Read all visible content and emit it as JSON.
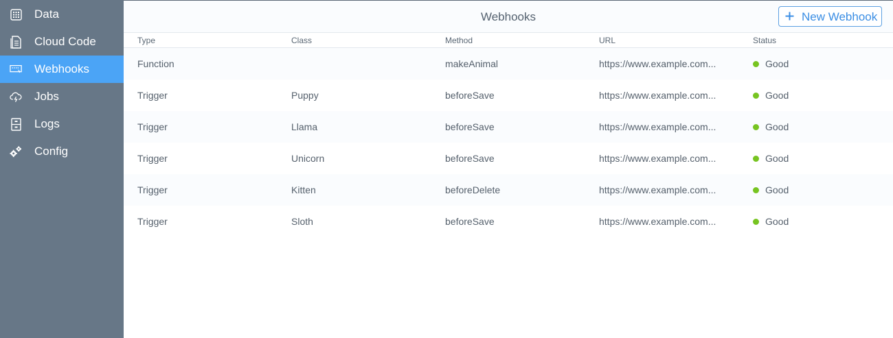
{
  "sidebar": {
    "items": [
      {
        "label": "Data",
        "icon": "grid-icon",
        "active": false
      },
      {
        "label": "Cloud Code",
        "icon": "document-icon",
        "active": false
      },
      {
        "label": "Webhooks",
        "icon": "webhook-icon",
        "active": true
      },
      {
        "label": "Jobs",
        "icon": "cloud-icon",
        "active": false
      },
      {
        "label": "Logs",
        "icon": "cabinet-icon",
        "active": false
      },
      {
        "label": "Config",
        "icon": "gears-icon",
        "active": false
      }
    ]
  },
  "header": {
    "title": "Webhooks",
    "new_button_label": "New Webhook"
  },
  "table": {
    "columns": [
      "Type",
      "Class",
      "Method",
      "URL",
      "Status"
    ],
    "rows": [
      {
        "type": "Function",
        "class": "",
        "method": "makeAnimal",
        "url": "https://www.example.com...",
        "status": "Good"
      },
      {
        "type": "Trigger",
        "class": "Puppy",
        "method": "beforeSave",
        "url": "https://www.example.com...",
        "status": "Good"
      },
      {
        "type": "Trigger",
        "class": "Llama",
        "method": "beforeSave",
        "url": "https://www.example.com...",
        "status": "Good"
      },
      {
        "type": "Trigger",
        "class": "Unicorn",
        "method": "beforeSave",
        "url": "https://www.example.com...",
        "status": "Good"
      },
      {
        "type": "Trigger",
        "class": "Kitten",
        "method": "beforeDelete",
        "url": "https://www.example.com...",
        "status": "Good"
      },
      {
        "type": "Trigger",
        "class": "Sloth",
        "method": "beforeSave",
        "url": "https://www.example.com...",
        "status": "Good"
      }
    ]
  },
  "colors": {
    "sidebar_bg": "#677787",
    "active_bg": "#4ba4f6",
    "accent": "#3b8ee4",
    "status_good": "#77c421"
  }
}
